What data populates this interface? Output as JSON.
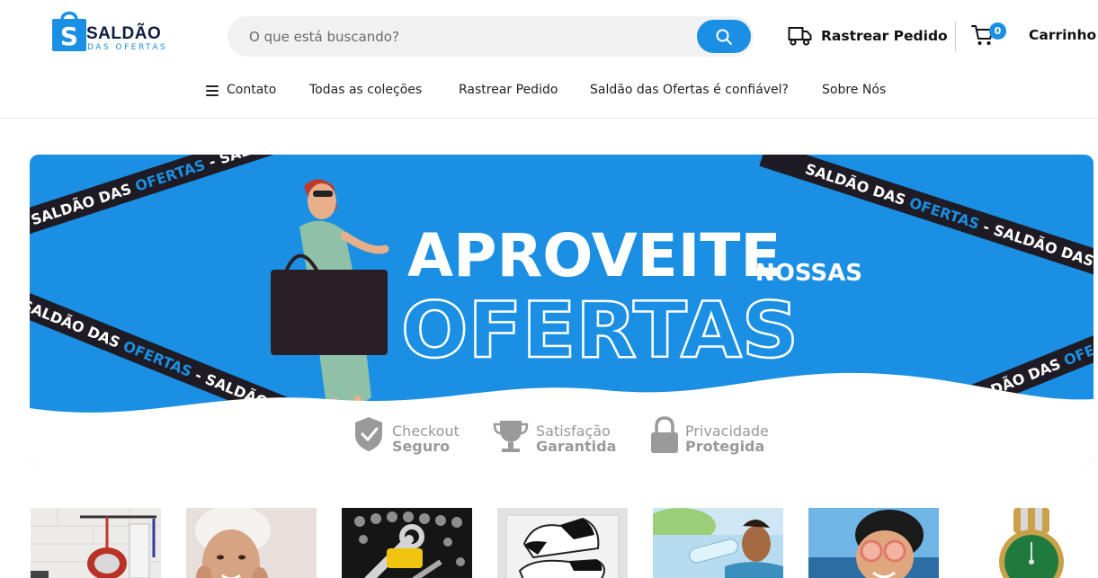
{
  "brand": {
    "line1": "SALDÃO",
    "line2": "DAS OFERTAS",
    "accent": "#1a8fe3",
    "dark": "#0d1b3e"
  },
  "search": {
    "placeholder": "O que está buscando?",
    "value": "",
    "icon": "search-icon"
  },
  "header": {
    "track_label": "Rastrear Pedido",
    "cart_label": "Carrinho",
    "cart_count": "0"
  },
  "nav": {
    "items": [
      "Contato",
      "Todas as coleções",
      "Rastrear Pedido",
      "Saldão das Ofertas é confiável?",
      "Sobre Nós"
    ]
  },
  "banner": {
    "headline1": "APROVEITE",
    "headline2": "NOSSAS",
    "headline3": "OFERTAS",
    "ribbon_text_a": "SALDÃO DAS ",
    "ribbon_text_b": "OFERTAS",
    "ribbon_text_c": " - ",
    "background": "#1a8fe3"
  },
  "trust": [
    {
      "line1": "Checkout",
      "line2": "Seguro",
      "icon": "shield-check-icon"
    },
    {
      "line1": "Satisfação",
      "line2": "Garantida",
      "icon": "trophy-icon"
    },
    {
      "line1": "Privacidade",
      "line2": "Protegida",
      "icon": "lock-icon"
    }
  ],
  "products": [
    {
      "name": "kitchen-utensils"
    },
    {
      "name": "skincare"
    },
    {
      "name": "tools"
    },
    {
      "name": "sneakers"
    },
    {
      "name": "fitness"
    },
    {
      "name": "kids-sunglasses"
    },
    {
      "name": "watch"
    }
  ]
}
